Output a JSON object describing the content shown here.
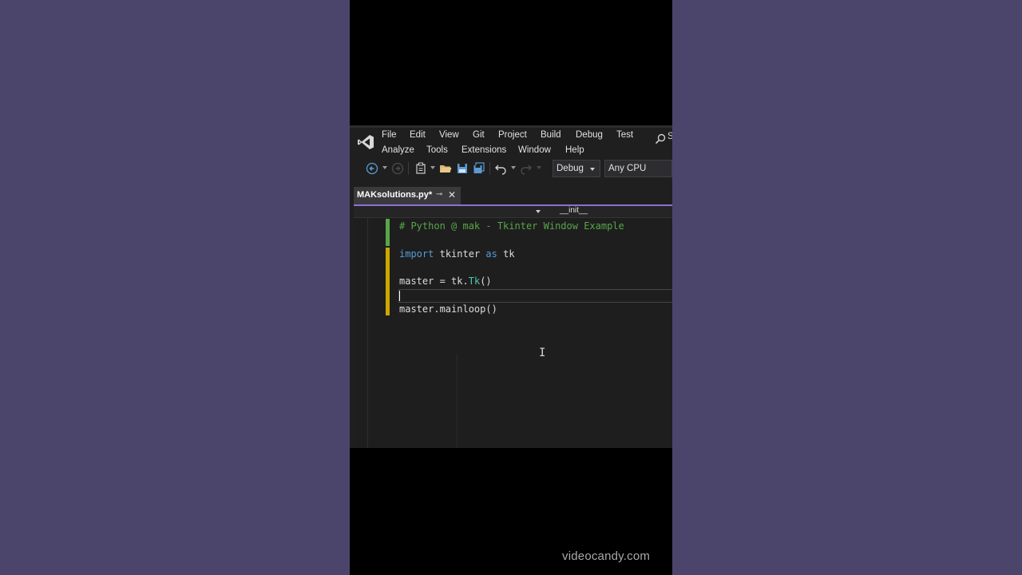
{
  "menu": {
    "row1": [
      "File",
      "Edit",
      "View",
      "Git",
      "Project",
      "Build",
      "Debug",
      "Test"
    ],
    "row2": [
      "Analyze",
      "Tools",
      "Extensions",
      "Window",
      "Help"
    ],
    "search_fragment": "S"
  },
  "toolbar": {
    "config_dropdown": "Debug",
    "platform_dropdown": "Any CPU",
    "icons": [
      "back-icon",
      "forward-icon",
      "new-project-icon",
      "open-folder-icon",
      "save-icon",
      "save-all-icon",
      "undo-icon",
      "redo-icon"
    ]
  },
  "tab": {
    "title": "MAKsolutions.py*",
    "pin_glyph": "⊸",
    "close_glyph": "✕"
  },
  "navbar": {
    "method": "__init__"
  },
  "editor": {
    "comment_line": "# Python @ mak - Tkinter Window Example",
    "import_kw": "import",
    "import_module": "tkinter",
    "as_kw": "as",
    "import_alias": "tk",
    "assign_var": "master",
    "assign_eq": " = ",
    "assign_obj": "tk.",
    "assign_cls": "Tk",
    "assign_paren": "()",
    "mainloop_line": "master.mainloop()"
  },
  "overlay": {
    "ibeam": "I",
    "watermark": "videocandy.com"
  },
  "colors": {
    "accent_purple": "#8b6fd6",
    "comment_green": "#57a64a",
    "keyword_blue": "#569cd6",
    "class_teal": "#4ec9b0",
    "change_yellow": "#cca700",
    "background_outer": "#4b456b"
  }
}
